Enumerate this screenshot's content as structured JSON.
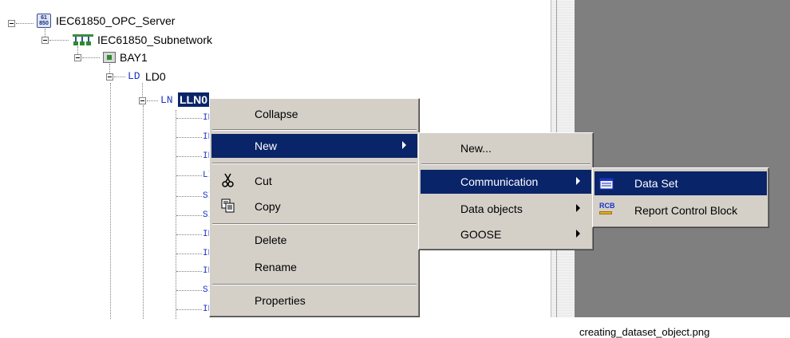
{
  "tree": {
    "server": "IEC61850_OPC_Server",
    "subnetwork": "IEC61850_Subnetwork",
    "bay": "BAY1",
    "ld_tag": "LD",
    "ld_label": "LD0",
    "ln_tag": "LN",
    "ln_label": "LLN0",
    "server_icon_text": "61\n850",
    "children_partial": [
      "IN",
      "IN",
      "IN",
      "LI",
      "SI",
      "SI",
      "IN",
      "IN",
      "IN",
      "SI",
      "IN"
    ]
  },
  "context_menu": {
    "items": [
      "Collapse",
      "New",
      "Cut",
      "Copy",
      "Delete",
      "Rename",
      "Properties"
    ]
  },
  "new_submenu": {
    "items": [
      "New...",
      "Communication",
      "Data objects",
      "GOOSE"
    ]
  },
  "communication_submenu": {
    "items": [
      "Data Set",
      "Report Control Block"
    ],
    "icons": [
      "dataset-icon",
      "rcb-icon"
    ],
    "rcb_icon_text": "RCB"
  },
  "caption": "creating_dataset_object.png",
  "colors": {
    "selection": "#0a246a",
    "menu": "#d4d0c8",
    "tree_tag": "#1a33c8",
    "panel": "#7f7f7f"
  }
}
